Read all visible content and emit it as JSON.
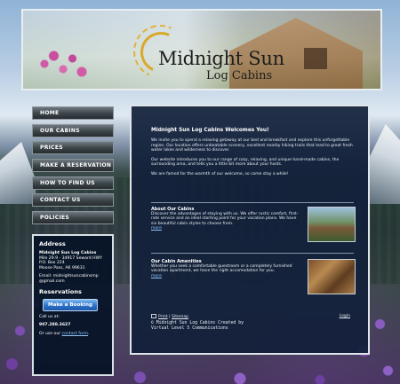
{
  "header": {
    "logo_title": "Midnight Sun",
    "logo_subtitle": "Log Cabins"
  },
  "nav": [
    {
      "label": "HOME"
    },
    {
      "label": "OUR CABINS"
    },
    {
      "label": "PRICES"
    },
    {
      "label": "MAKE A RESERVATION"
    },
    {
      "label": "HOW TO FIND US"
    },
    {
      "label": "CONTACT US"
    },
    {
      "label": "POLICIES"
    }
  ],
  "sidebar": {
    "address_heading": "Address",
    "business_name": "Midnight Sun Log Cabins",
    "address_line1": "Mile 29.9 - 34917 Seward HWY",
    "address_line2": "P.O. Box 224",
    "address_line3": "Moose Pass, AK 99631",
    "email_line1": "Email: midnightsuncabinsmp",
    "email_line2": "@gmail.com",
    "reservations_heading": "Reservations",
    "booking_button": "Make a Booking",
    "call_us": "Call us at:",
    "phone": "907.288.3627",
    "or_use": "Or use our",
    "contact_form": "contact form",
    "period": "."
  },
  "main": {
    "heading": "Midnight Sun Log Cabins Welcomes You!",
    "p1": "We invite you to spend a relaxing getaway at our bed and breakfast and explore this unforgettable region. Our location offers unbeatable scenery, excellent nearby hiking trails that lead to great fresh water lakes and wilderness to discover.",
    "p2": "Our website introduces you to our range of cozy, relaxing, and unique hand-made cabins, the surrounding area, and tells you a little bit more about your hosts.",
    "p3": "We are famed for the warmth of our welcome, so come stay a while!",
    "features": [
      {
        "title": "About Our Cabins",
        "body": "Discover the advantages of staying with us. We offer rustic comfort, first-rate service and an ideal starting point for your vacation plans. We have six beautiful cabin styles to choose from.",
        "more": "more"
      },
      {
        "title": "Our Cabin Amenities",
        "body": "Whether you seek a comfortable guestroom or a completely furnished vacation apartment, we have the right accomodation for you.",
        "more": "more"
      }
    ],
    "footer": {
      "print": "Print",
      "sep": " | ",
      "sitemap": "Sitemap",
      "login": "Login",
      "copyright_line1": "© Midnight Sun Log Cabins Created by",
      "copyright_line2": "Virtual Level 5 Communications"
    }
  }
}
